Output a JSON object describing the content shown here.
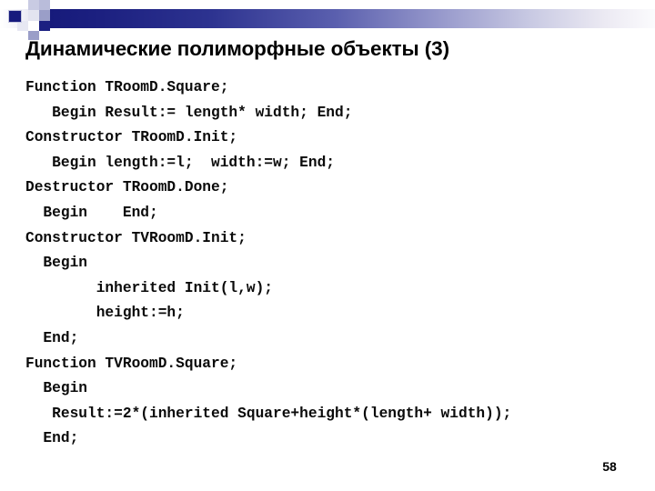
{
  "slide": {
    "title": "Динамические полиморфные объекты (3)",
    "page_number": "58",
    "code_lines": [
      "Function TRoomD.Square;",
      "   Begin Result:= length* width; End;",
      "Constructor TRoomD.Init;",
      "   Begin length:=l;  width:=w; End;",
      "Destructor TRoomD.Done;",
      "  Begin    End;",
      "Constructor TVRoomD.Init;",
      "  Begin",
      "        inherited Init(l,w);",
      "        height:=h;",
      "  End;",
      "Function TVRoomD.Square;",
      "  Begin",
      "   Result:=2*(inherited Square+height*(length+ width));",
      "  End;"
    ]
  },
  "theme": {
    "banner_gradient_start": "#15197a",
    "banner_gradient_end": "#fbfbfd",
    "accent_square": "#161a7d",
    "accent_light": "#9a9ec8",
    "background": "#ffffff",
    "text_color": "#000000"
  }
}
